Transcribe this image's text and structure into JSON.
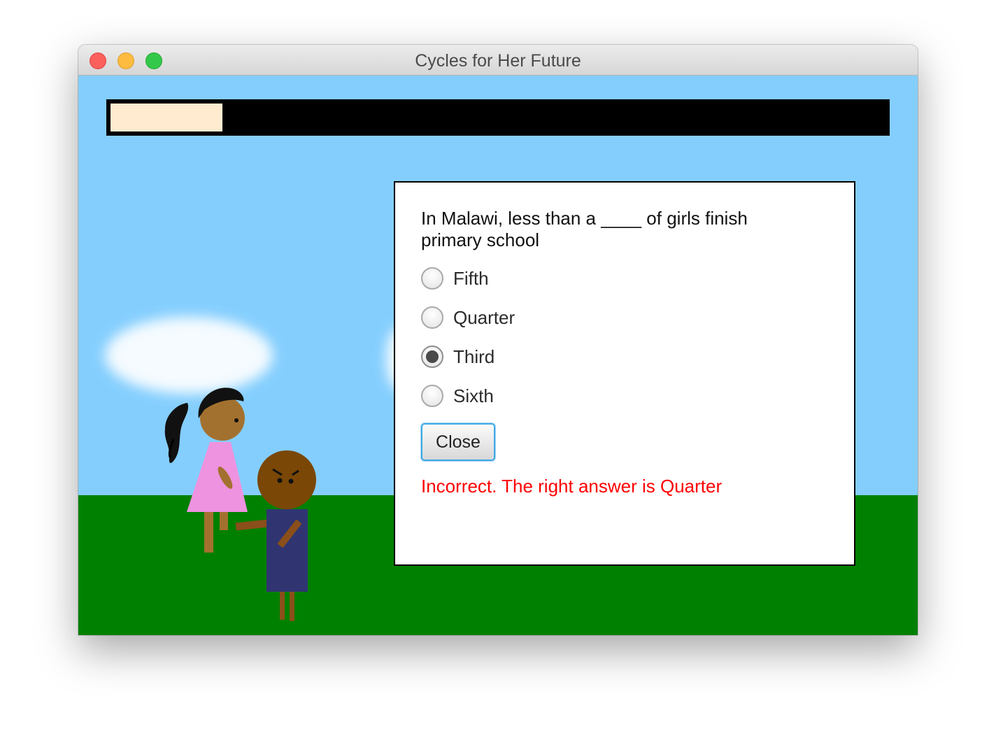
{
  "window": {
    "title": "Cycles for Her Future"
  },
  "progress": {
    "fraction": 0.144,
    "fill_color": "#ffebd0"
  },
  "scene": {
    "sky_color": "#84cefe",
    "ground_color": "#008000",
    "characters": [
      {
        "name": "girl",
        "dress_color": "#ee93df"
      },
      {
        "name": "boy",
        "shirt_color": "#303572"
      }
    ]
  },
  "dialog": {
    "question": "In Malawi, less than a ____ of girls finish primary school",
    "options": [
      {
        "label": "Fifth",
        "selected": false
      },
      {
        "label": "Quarter",
        "selected": false
      },
      {
        "label": "Third",
        "selected": true
      },
      {
        "label": "Sixth",
        "selected": false
      }
    ],
    "close_label": "Close",
    "feedback": "Incorrect. The right answer is Quarter",
    "feedback_color": "#ff0000"
  }
}
